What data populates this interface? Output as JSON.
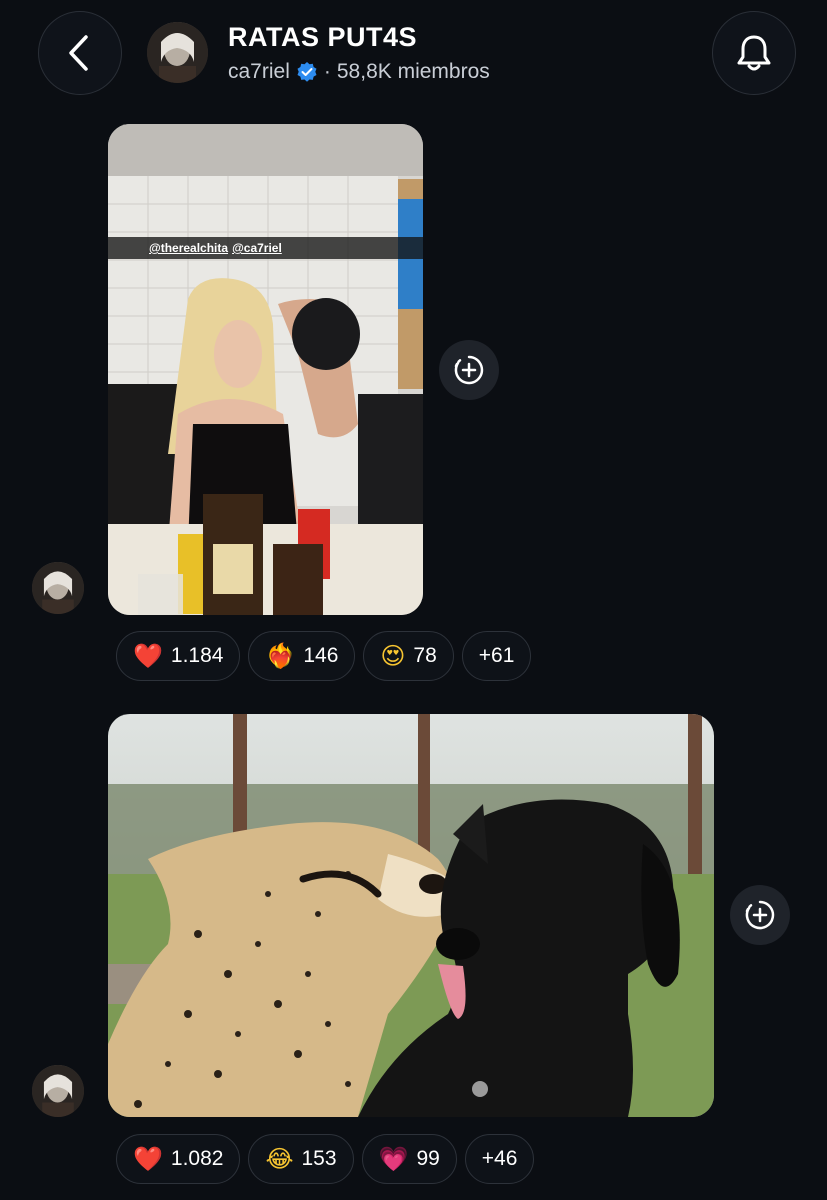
{
  "header": {
    "title": "RATAS PUT4S",
    "channel_name": "ca7riel",
    "separator": "·",
    "members": "58,8K miembros",
    "back_icon": "chevron-left-icon",
    "bell_icon": "bell-icon"
  },
  "messages": [
    {
      "photo_caption_tags": [
        "@therealchita",
        "@ca7riel"
      ],
      "reactions": [
        {
          "emoji": "❤️",
          "count": "1.184"
        },
        {
          "emoji": "❤️‍🔥",
          "count": "146"
        },
        {
          "emoji": "😍",
          "count": "78"
        },
        {
          "emoji": "",
          "count": "+61"
        }
      ]
    },
    {
      "reactions": [
        {
          "emoji": "❤️",
          "count": "1.082"
        },
        {
          "emoji": "😂",
          "count": "153"
        },
        {
          "emoji": "💗",
          "count": "99"
        },
        {
          "emoji": "",
          "count": "+46"
        }
      ]
    }
  ],
  "colors": {
    "background": "#0b0e13",
    "verified": "#2d8cf0",
    "pill_border": "#2d323a"
  }
}
